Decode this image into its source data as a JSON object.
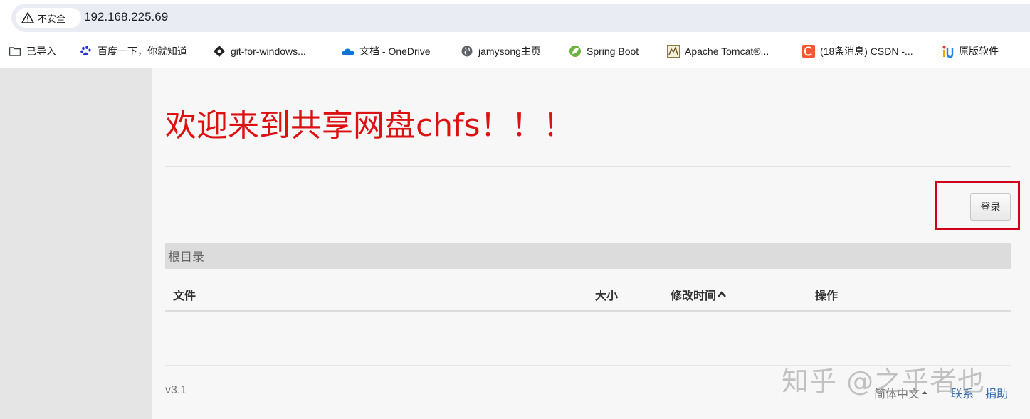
{
  "browser": {
    "security_label": "不安全",
    "url": "192.168.225.69"
  },
  "bookmarks": [
    {
      "label": "已导入",
      "icon": "folder-icon"
    },
    {
      "label": "百度一下，你就知道",
      "icon": "baidu-paw-icon"
    },
    {
      "label": "git-for-windows...",
      "icon": "git-icon"
    },
    {
      "label": "文档 - OneDrive",
      "icon": "onedrive-cloud-icon"
    },
    {
      "label": "jamysong主页",
      "icon": "globe-icon"
    },
    {
      "label": "Spring Boot",
      "icon": "spring-leaf-icon"
    },
    {
      "label": "Apache Tomcat®...",
      "icon": "tomcat-icon"
    },
    {
      "label": "(18条消息) CSDN -...",
      "icon": "csdn-icon"
    },
    {
      "label": "原版软件",
      "icon": "itellyou-icon"
    }
  ],
  "page": {
    "welcome": "欢迎来到共享网盘chfs！！！",
    "login_button": "登录",
    "breadcrumb": "根目录",
    "table_headers": {
      "file": "文件",
      "size": "大小",
      "modified": "修改时间",
      "actions": "操作"
    },
    "footer": {
      "version": "v3.1",
      "language": "简体中文",
      "contact": "联系",
      "donate": "捐助"
    },
    "watermark": "知乎 @之乎者也"
  },
  "colors": {
    "welcome_red": "#dd1111",
    "highlight_red": "#d0021b",
    "link_blue": "#3a6fb0"
  }
}
